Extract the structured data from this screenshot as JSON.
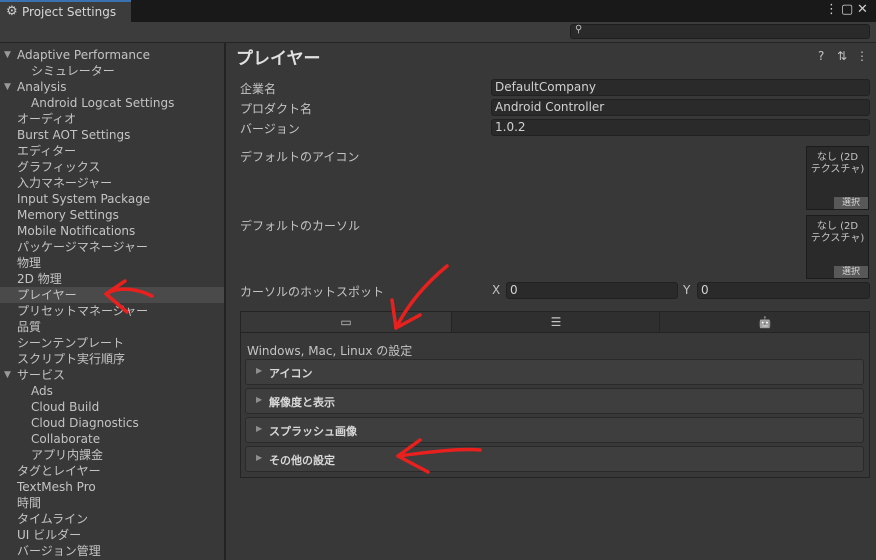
{
  "window": {
    "tab_title": "Project Settings",
    "tab_icon": "gear-icon",
    "controls": [
      "⋮",
      "▢",
      "✕"
    ]
  },
  "search": {
    "placeholder": "",
    "icon": "search-icon"
  },
  "sidebar": {
    "items": [
      {
        "label": "Adaptive Performance",
        "expanded": true,
        "level": 0
      },
      {
        "label": "シミュレーター",
        "level": 1
      },
      {
        "label": "Analysis",
        "expanded": true,
        "level": 0
      },
      {
        "label": "Android Logcat Settings",
        "level": 1
      },
      {
        "label": "オーディオ",
        "level": 0
      },
      {
        "label": "Burst AOT Settings",
        "level": 0
      },
      {
        "label": "エディター",
        "level": 0
      },
      {
        "label": "グラフィックス",
        "level": 0
      },
      {
        "label": "入力マネージャー",
        "level": 0
      },
      {
        "label": "Input System Package",
        "level": 0
      },
      {
        "label": "Memory Settings",
        "level": 0
      },
      {
        "label": "Mobile Notifications",
        "level": 0
      },
      {
        "label": "パッケージマネージャー",
        "level": 0
      },
      {
        "label": "物理",
        "level": 0
      },
      {
        "label": "2D 物理",
        "level": 0
      },
      {
        "label": "プレイヤー",
        "level": 0,
        "selected": true
      },
      {
        "label": "プリセットマネージャー",
        "level": 0
      },
      {
        "label": "品質",
        "level": 0
      },
      {
        "label": "シーンテンプレート",
        "level": 0
      },
      {
        "label": "スクリプト実行順序",
        "level": 0
      },
      {
        "label": "サービス",
        "expanded": true,
        "level": 0
      },
      {
        "label": "Ads",
        "level": 1
      },
      {
        "label": "Cloud Build",
        "level": 1
      },
      {
        "label": "Cloud Diagnostics",
        "level": 1
      },
      {
        "label": "Collaborate",
        "level": 1
      },
      {
        "label": "アプリ内課金",
        "level": 1
      },
      {
        "label": "タグとレイヤー",
        "level": 0
      },
      {
        "label": "TextMesh Pro",
        "level": 0
      },
      {
        "label": "時間",
        "level": 0
      },
      {
        "label": "タイムライン",
        "level": 0
      },
      {
        "label": "UI ビルダー",
        "level": 0
      },
      {
        "label": "バージョン管理",
        "level": 0
      }
    ]
  },
  "main": {
    "title": "プレイヤー",
    "header_icons": [
      "help-icon",
      "preset-icon",
      "more-icon"
    ],
    "header_glyphs": [
      "?",
      "⇅",
      "⋮"
    ],
    "company_label": "企業名",
    "company_value": "DefaultCompany",
    "product_label": "プロダクト名",
    "product_value": "Android Controller",
    "version_label": "バージョン",
    "version_value": "1.0.2",
    "default_icon_label": "デフォルトのアイコン",
    "default_cursor_label": "デフォルトのカーソル",
    "texture_none_line1": "なし (2D",
    "texture_none_line2": "テクスチャ)",
    "select_label": "選択",
    "hotspot_label": "カーソルのホットスポット",
    "hotspot_x_label": "X",
    "hotspot_x_value": "0",
    "hotspot_y_label": "Y",
    "hotspot_y_value": "0"
  },
  "platform": {
    "tabs": [
      {
        "icon": "monitor-icon",
        "glyph": "▭",
        "active": true
      },
      {
        "icon": "server-icon",
        "glyph": "☰",
        "active": false
      },
      {
        "icon": "android-icon",
        "glyph": "🤖",
        "active": false
      }
    ],
    "settings_title": "Windows, Mac, Linux の設定",
    "sections": [
      "アイコン",
      "解像度と表示",
      "スプラッシュ画像",
      "その他の設定"
    ]
  },
  "colors": {
    "background": "#383838",
    "titlebar": "#191919",
    "selected_row": "#4a4a4a",
    "annotation_arrow": "#e8201e"
  }
}
